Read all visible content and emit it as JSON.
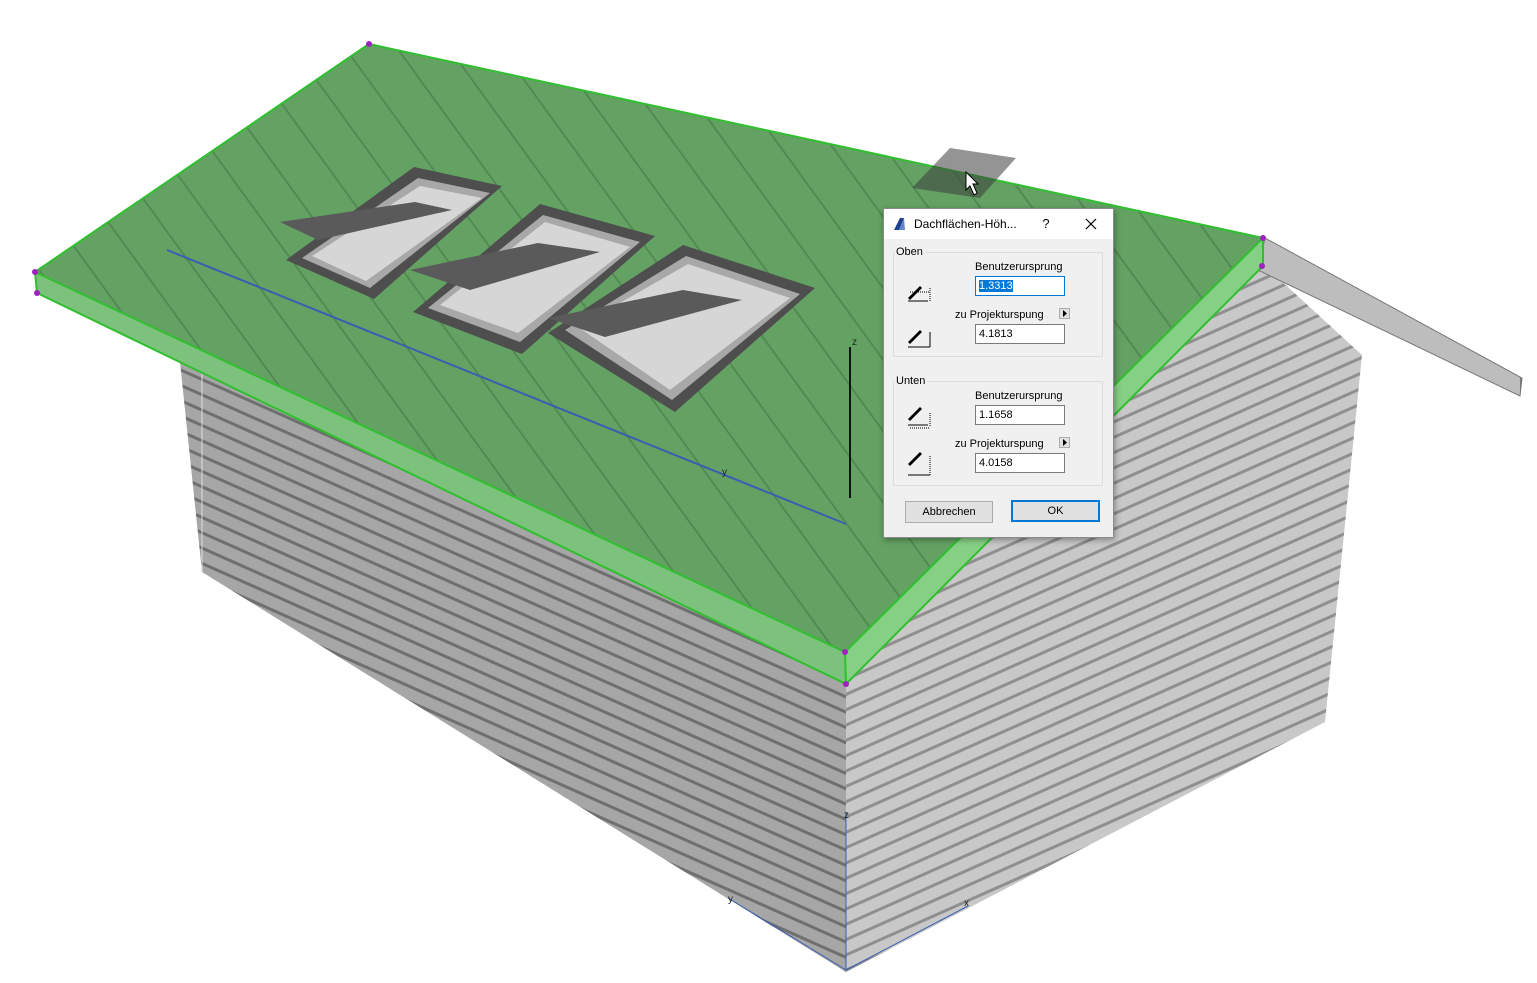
{
  "dialog": {
    "title": "Dachflächen-Höh...",
    "help_label": "?",
    "top_group": {
      "label": "Oben",
      "user_origin_label": "Benutzerursprung",
      "user_origin_value": "1.3313",
      "project_origin_label": "zu Projekturspung",
      "project_origin_value": "4.1813"
    },
    "bottom_group": {
      "label": "Unten",
      "user_origin_label": "Benutzerursprung",
      "user_origin_value": "1.1658",
      "project_origin_label": "zu Projekturspung",
      "project_origin_value": "4.0158"
    },
    "cancel_label": "Abbrechen",
    "ok_label": "OK"
  },
  "scene": {
    "axis_labels": {
      "roof_z": "z",
      "roof_y": "y",
      "base_z": "z",
      "base_y": "y",
      "base_x": "x"
    },
    "colors": {
      "roof_selected": "#5fa35f",
      "roof_edge": "#37b837",
      "hotspot": "#a020c0",
      "wall": "#b4b4b4"
    }
  }
}
